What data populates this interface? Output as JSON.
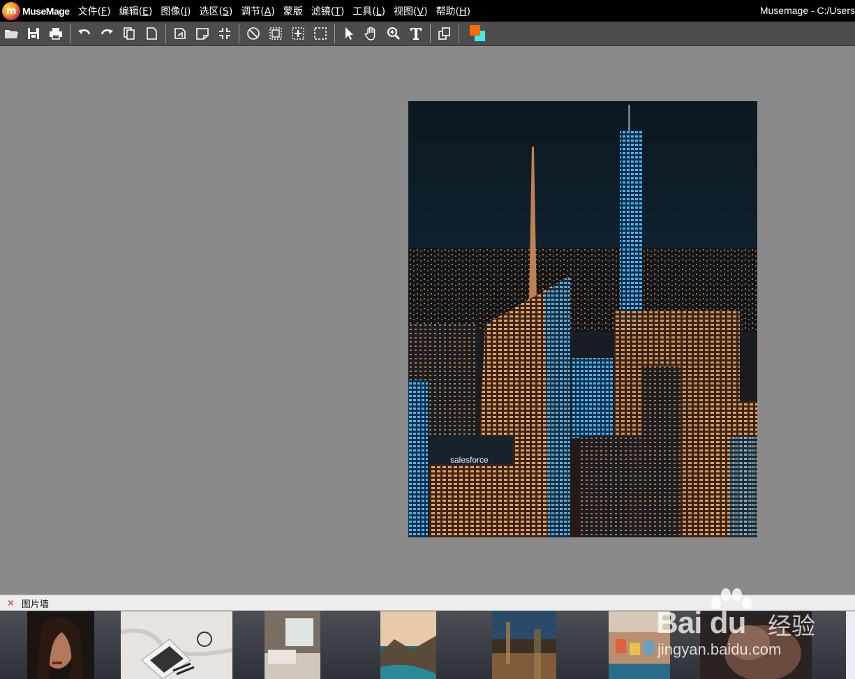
{
  "app": {
    "logo_letter": "m",
    "logo_name": "MuseMage",
    "window_title": "Musemage - C:/Users"
  },
  "menu": [
    {
      "label": "文件(",
      "key": "F",
      "tail": ")"
    },
    {
      "label": "编辑(",
      "key": "E",
      "tail": ")"
    },
    {
      "label": "图像(",
      "key": "I",
      "tail": ")"
    },
    {
      "label": "选区(",
      "key": "S",
      "tail": ")"
    },
    {
      "label": "调节(",
      "key": "A",
      "tail": ")"
    },
    {
      "label": "蒙版",
      "key": "",
      "tail": ""
    },
    {
      "label": "滤镜(",
      "key": "T",
      "tail": ")"
    },
    {
      "label": "工具(",
      "key": "L",
      "tail": ")"
    },
    {
      "label": "视图(",
      "key": "V",
      "tail": ")"
    },
    {
      "label": "帮助(",
      "key": "H",
      "tail": ")"
    }
  ],
  "toolbar": {
    "icons": [
      "open-folder-icon",
      "save-icon",
      "print-icon",
      "undo-icon",
      "redo-icon",
      "copy-icon",
      "paste-icon",
      "rotate-icon",
      "crop-perspective-icon",
      "fit-icon",
      "deselect-icon",
      "select-all-icon",
      "select-center-icon",
      "marquee-icon",
      "pointer-icon",
      "hand-icon",
      "zoom-icon",
      "text-icon",
      "layers-icon"
    ],
    "foreground_color": "#ff6a00",
    "background_color": "#39f0f0"
  },
  "canvas": {
    "image_description_icon": "city-night-photo"
  },
  "photo_wall": {
    "close_symbol": "×",
    "title": "图片墙"
  },
  "watermark": {
    "brand": "Bai du",
    "brand_cn": "经验",
    "url": "jingyan.baidu.com"
  }
}
